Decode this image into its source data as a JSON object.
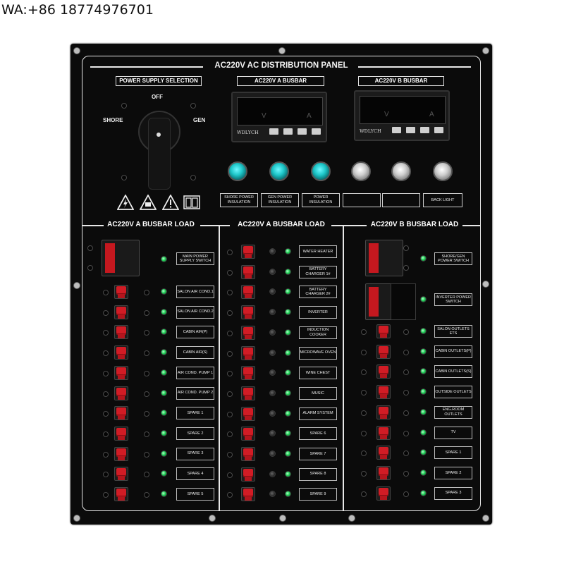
{
  "contact": "WA:+86 18774976701",
  "panel": {
    "title": "AC220V AC DISTRIBUTION PANEL",
    "power_supply_selection": "POWER SUPPLY SELECTION",
    "selector_positions": {
      "off": "OFF",
      "shore": "SHORE",
      "gen": "GEN"
    },
    "meter_a_title": "AC220V A BUSBAR",
    "meter_b_title": "AC220V B BUSBAR",
    "meter_brand": "WDLYCH",
    "meter_v": "V",
    "meter_a": "A",
    "indicator_labels": [
      "SHORE POWER INSULATION",
      "GEN POWER INSULATION",
      "POWER INSULATION",
      "",
      "",
      "BACK LIGHT"
    ],
    "section_titles": [
      "AC220V A BUSBAR LOAD",
      "AC220V A BUSBAR LOAD",
      "AC220V B BUSBAR LOAD"
    ]
  },
  "col1": [
    "MAIN POWER SUPPLY SWITCH",
    "SALON AIR COND.1",
    "SALON AIR COND.2",
    "CABIN AIR(P)",
    "CABIN AIR(S)",
    "AIR COND. PUMP 1",
    "AIR COND. PUMP 2",
    "SPARE 1",
    "SPARE 2",
    "SPARE 3",
    "SPARE 4",
    "SPARE 5"
  ],
  "col2": [
    "WATER HEATER",
    "BATTERY CHARGER 1#",
    "BATTERY CHARGER 2#",
    "INVERTER",
    "INDUCTION COOKER",
    "MICROWAVE OVEN",
    "WINE CHEST",
    "MUSIC",
    "ALARM SYSTEM",
    "SPARE 6",
    "SPARE 7",
    "SPARE 8",
    "SPARE 9"
  ],
  "col3": [
    "SHORE/GEN POWER SWITCH",
    "INVERTER POWER SWITCH",
    "SALON OUTLETS ETS",
    "CABIN OUTLETS(P)",
    "CABIN OUTLETS(S)",
    "OUTSIDE OUTLETS",
    "ENG.ROOM OUTLETS",
    "TV",
    "SPARE 1",
    "SPARE 2",
    "SPARE 3"
  ],
  "colors": {
    "panel": "#0b0b0b",
    "breaker_red": "#d11c25",
    "lamp_cyan": "#1ec7c9",
    "led_green": "#24d25a"
  }
}
